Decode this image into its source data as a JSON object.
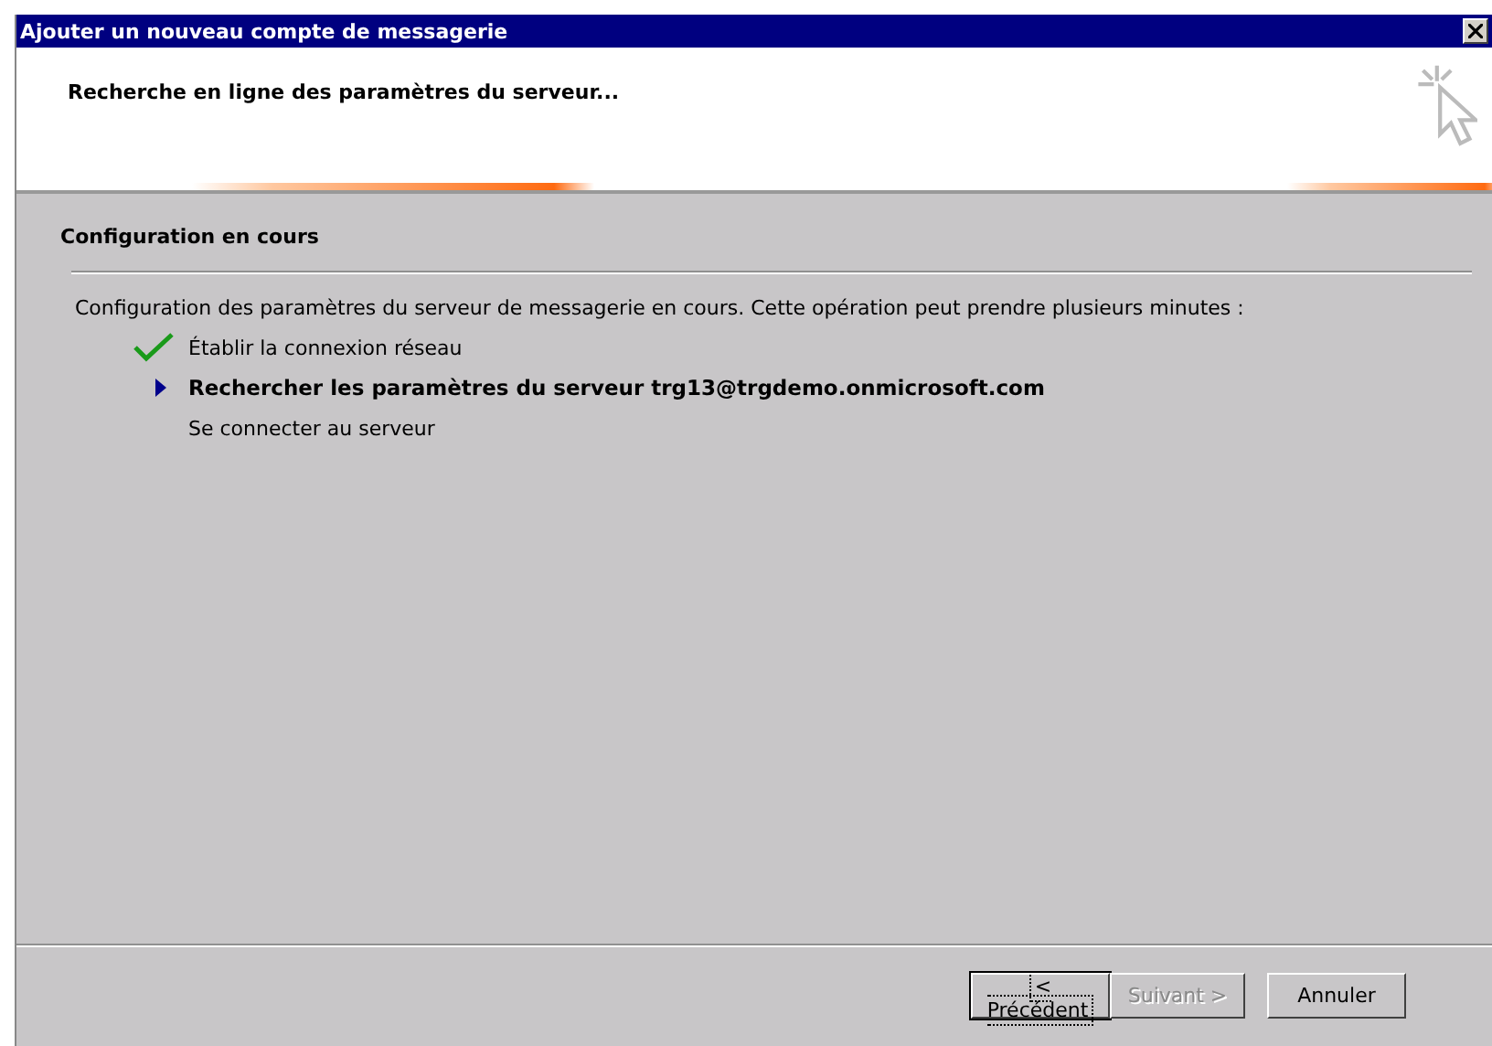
{
  "window": {
    "title": "Ajouter un nouveau compte de messagerie"
  },
  "header": {
    "title": "Recherche en ligne des paramètres du serveur..."
  },
  "section": {
    "title": "Configuration en cours",
    "description": "Configuration des paramètres du serveur de messagerie en cours. Cette opération peut prendre plusieurs minutes :"
  },
  "steps": [
    {
      "label": "Établir la connexion réseau",
      "kind": "done"
    },
    {
      "label": "Rechercher les paramètres du serveur trg13@trgdemo.onmicrosoft.com",
      "kind": "current"
    },
    {
      "label": "Se connecter au serveur",
      "kind": "pending"
    }
  ],
  "buttons": [
    {
      "label": "< Précédent",
      "disabled": false,
      "default": true
    },
    {
      "label": "Suivant >",
      "disabled": true,
      "default": false
    },
    {
      "label": "Annuler",
      "disabled": false,
      "default": false
    }
  ]
}
